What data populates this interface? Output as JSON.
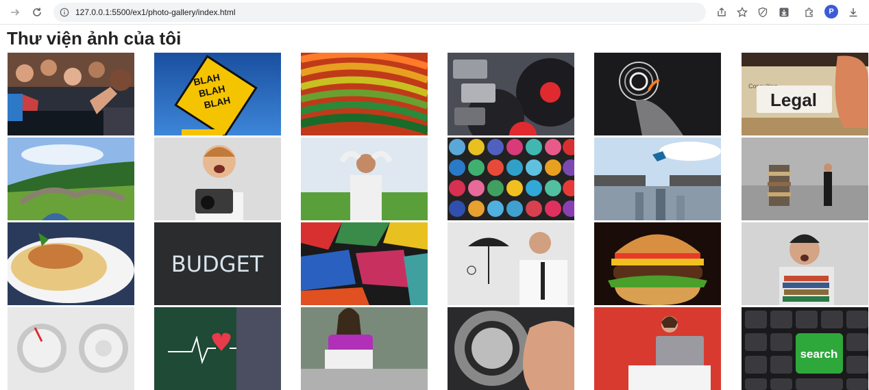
{
  "browser": {
    "url": "127.0.0.1:5500/ex1/photo-gallery/index.html",
    "profile_initial": "P"
  },
  "page": {
    "title": "Thư viện ảnh của tôi"
  },
  "gallery": {
    "photos": [
      {
        "subject": "concert-crowd"
      },
      {
        "subject": "blah-blah-blah-road-sign",
        "text": "BLAH BLAH BLAH"
      },
      {
        "subject": "colorful-wavy-lines"
      },
      {
        "subject": "cassette-tapes-and-vinyl-records"
      },
      {
        "subject": "hand-touching-digital-circle"
      },
      {
        "subject": "legal-file-folder",
        "text": "Legal",
        "subtext": "Consulting"
      },
      {
        "subject": "stone-bridge-landscape"
      },
      {
        "subject": "excited-boy-with-camera"
      },
      {
        "subject": "relaxed-man-in-field"
      },
      {
        "subject": "spray-paint-cans"
      },
      {
        "subject": "man-jumping-over-city-gap"
      },
      {
        "subject": "businessman-beside-stack-of-books"
      },
      {
        "subject": "pasta-dish"
      },
      {
        "subject": "budget-chalkboard",
        "text": "BUDGET"
      },
      {
        "subject": "graffiti-wall"
      },
      {
        "subject": "businessman-with-umbrella-drawing"
      },
      {
        "subject": "hamburger"
      },
      {
        "subject": "tired-man-with-books"
      },
      {
        "subject": "two-control-knobs"
      },
      {
        "subject": "doctor-with-heartbeat-heart"
      },
      {
        "subject": "woman-with-laptop"
      },
      {
        "subject": "safe-combination-dial"
      },
      {
        "subject": "woman-with-laptop-red-background"
      },
      {
        "subject": "search-key-keyboard",
        "text": "search"
      }
    ]
  }
}
